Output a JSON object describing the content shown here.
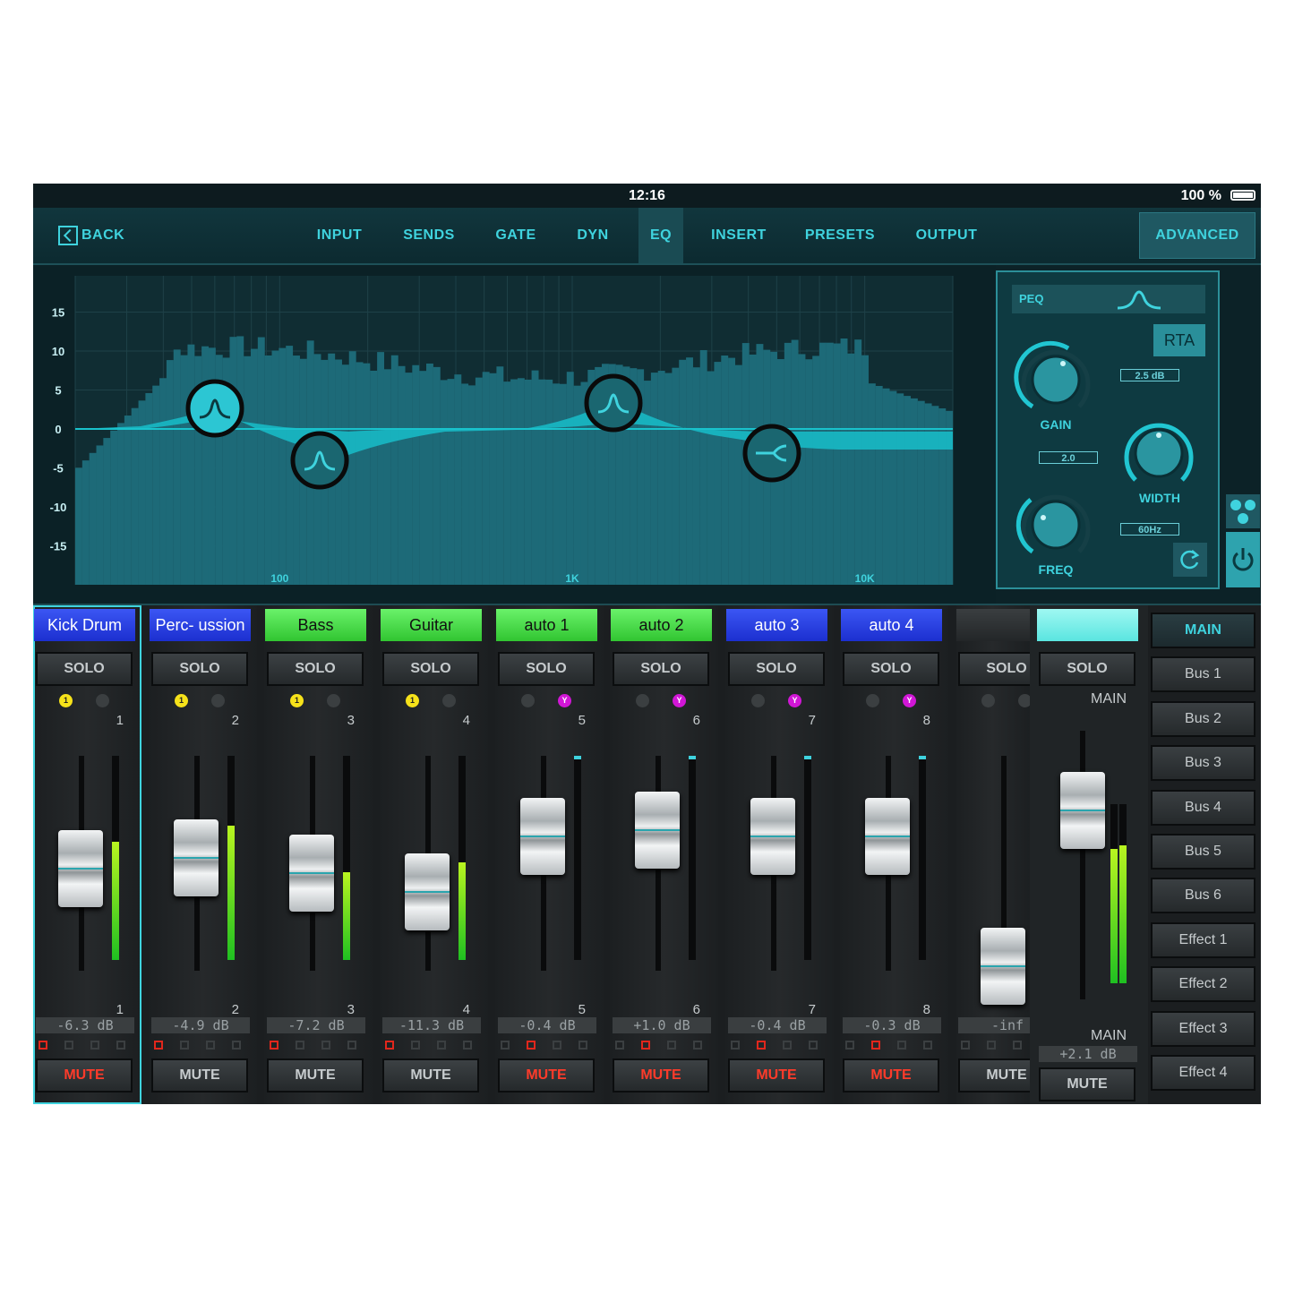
{
  "status": {
    "time": "12:16",
    "battery": "100 %"
  },
  "nav": {
    "back": "BACK",
    "tabs": [
      "INPUT",
      "SENDS",
      "GATE",
      "DYN",
      "EQ",
      "INSERT",
      "PRESETS",
      "OUTPUT"
    ],
    "active_tab": "EQ",
    "advanced": "ADVANCED"
  },
  "eq": {
    "y_labels": [
      "15",
      "10",
      "5",
      "0",
      "-5",
      "-10",
      "-15"
    ],
    "x_labels": [
      "100",
      "1K",
      "10K"
    ],
    "panel": {
      "mode": "PEQ",
      "rta": "RTA",
      "gain_label": "GAIN",
      "gain_value": "2.5 dB",
      "width_label": "WIDTH",
      "width_value": "2.0",
      "freq_label": "FREQ",
      "freq_value": "60Hz"
    },
    "colors": {
      "accent": "#3fd3de",
      "spectrum": "#1d6a78",
      "curve": "#19c2cc"
    }
  },
  "channels": [
    {
      "name": "Kick Drum",
      "color": "blue",
      "solo": "SOLO",
      "mute": "MUTE",
      "mute_on": true,
      "num": "1",
      "db": "-6.3 dB",
      "dot1": "1",
      "dot2": "",
      "level": 0.58,
      "fader": 0.53
    },
    {
      "name": "Perc- ussion",
      "color": "blue",
      "solo": "SOLO",
      "mute": "MUTE",
      "mute_on": false,
      "num": "2",
      "db": "-4.9 dB",
      "dot1": "1",
      "dot2": "",
      "level": 0.66,
      "fader": 0.58
    },
    {
      "name": "Bass",
      "color": "green",
      "solo": "SOLO",
      "mute": "MUTE",
      "mute_on": false,
      "num": "3",
      "db": "-7.2 dB",
      "dot1": "1",
      "dot2": "",
      "level": 0.43,
      "fader": 0.51
    },
    {
      "name": "Guitar",
      "color": "green",
      "solo": "SOLO",
      "mute": "MUTE",
      "mute_on": false,
      "num": "4",
      "db": "-11.3 dB",
      "dot1": "1",
      "dot2": "",
      "level": 0.48,
      "fader": 0.42
    },
    {
      "name": "auto 1",
      "color": "green",
      "solo": "SOLO",
      "mute": "MUTE",
      "mute_on": true,
      "num": "5",
      "db": "-0.4 dB",
      "dot1": "",
      "dot2": "Y",
      "level": 0.0,
      "fader": 0.68
    },
    {
      "name": "auto 2",
      "color": "green",
      "solo": "SOLO",
      "mute": "MUTE",
      "mute_on": true,
      "num": "6",
      "db": "+1.0 dB",
      "dot1": "",
      "dot2": "Y",
      "level": 0.0,
      "fader": 0.71
    },
    {
      "name": "auto 3",
      "color": "blue",
      "solo": "SOLO",
      "mute": "MUTE",
      "mute_on": true,
      "num": "7",
      "db": "-0.4 dB",
      "dot1": "",
      "dot2": "Y",
      "level": 0.0,
      "fader": 0.68
    },
    {
      "name": "auto 4",
      "color": "blue",
      "solo": "SOLO",
      "mute": "MUTE",
      "mute_on": true,
      "num": "8",
      "db": "-0.3 dB",
      "dot1": "",
      "dot2": "Y",
      "level": 0.0,
      "fader": 0.68
    },
    {
      "name": "",
      "color": "dark",
      "solo": "SOLO",
      "mute": "MUTE",
      "mute_on": false,
      "num": "",
      "db": "-inf",
      "dot1": "",
      "dot2": "",
      "level": 0.0,
      "fader": 0.0
    }
  ],
  "main": {
    "name": "",
    "solo": "SOLO",
    "label_top": "MAIN",
    "label_bottom": "MAIN",
    "db": "+2.1 dB",
    "mute": "MUTE",
    "level": 0.75,
    "fader": 0.78
  },
  "buses": [
    "MAIN",
    "Bus 1",
    "Bus 2",
    "Bus 3",
    "Bus 4",
    "Bus 5",
    "Bus 6",
    "Effect 1",
    "Effect 2",
    "Effect 3",
    "Effect 4"
  ],
  "active_bus": "MAIN"
}
